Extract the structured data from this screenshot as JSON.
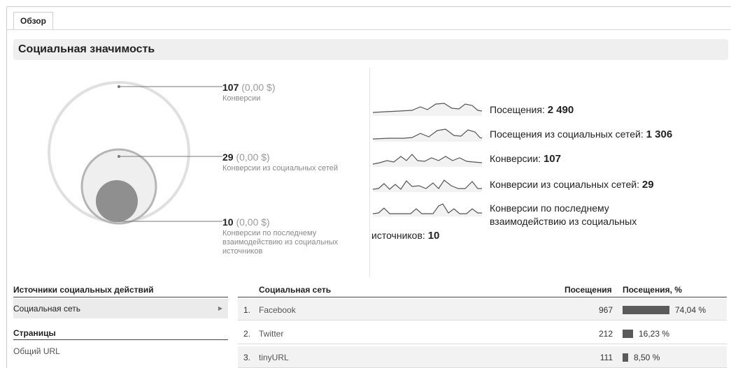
{
  "tab": {
    "label": "Обзор"
  },
  "section_title": "Социальная значимость",
  "venn_labels": [
    {
      "count": "107",
      "amount": "(0,00 $)",
      "caption": "Конверсии"
    },
    {
      "count": "29",
      "amount": "(0,00 $)",
      "caption": "Конверсии из социальных сетей"
    },
    {
      "count": "10",
      "amount": "(0,00 $)",
      "caption": "Конверсии по последнему взаимодействию из социальных источников"
    }
  ],
  "metrics": [
    {
      "label": "Посещения: ",
      "value": "2 490"
    },
    {
      "label": "Посещения из социальных сетей: ",
      "value": "1 306"
    },
    {
      "label": "Конверсии: ",
      "value": "107"
    },
    {
      "label": "Конверсии из социальных сетей: ",
      "value": "29"
    },
    {
      "label": "Конверсии по последнему взаимодействию из социальных",
      "label_cont": "источников: ",
      "value": "10"
    }
  ],
  "left_panel": {
    "heading1": "Источники социальных действий",
    "item1": "Социальная сеть",
    "heading2": "Страницы",
    "item2": "Общий URL"
  },
  "table": {
    "col_network": "Социальная сеть",
    "col_visits": "Посещения",
    "col_pct": "Посещения, %",
    "rows": [
      {
        "num": "1.",
        "name": "Facebook",
        "visits": "967",
        "pct": "74,04 %",
        "share": 74.04
      },
      {
        "num": "2.",
        "name": "Twitter",
        "visits": "212",
        "pct": "16,23 %",
        "share": 16.23
      },
      {
        "num": "3.",
        "name": "tinyURL",
        "visits": "111",
        "pct": "8,50 %",
        "share": 8.5
      }
    ]
  },
  "colors": {
    "bar": "#5a5a5a",
    "circle_outer": "#e0e0e0",
    "circle_mid": "#b5b5b5",
    "circle_inner": "#8f8f8f"
  }
}
